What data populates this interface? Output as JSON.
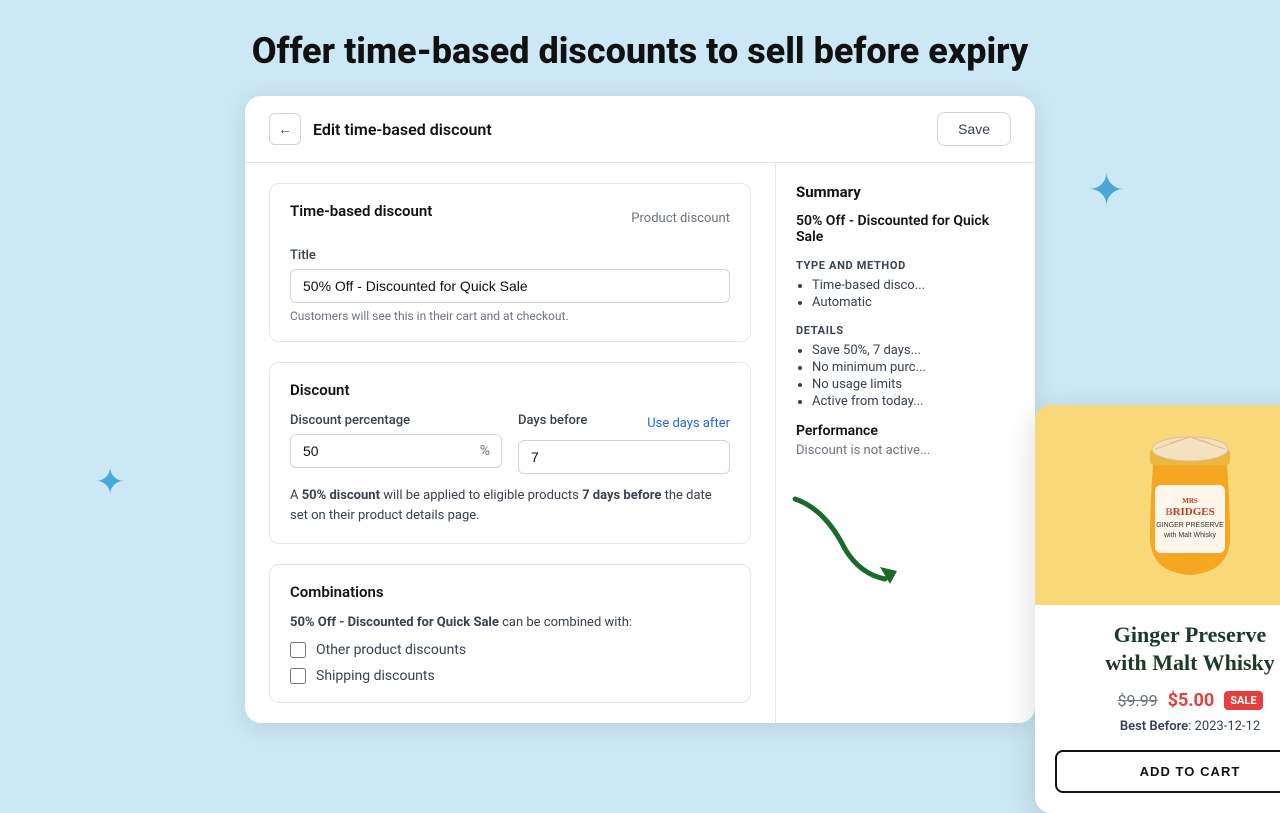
{
  "page": {
    "heading": "Offer time-based discounts to sell before expiry"
  },
  "header": {
    "title": "Edit time-based discount",
    "save_label": "Save",
    "back_icon": "←"
  },
  "time_based_discount": {
    "section_title": "Time-based discount",
    "product_discount_label": "Product discount",
    "title_label": "Title",
    "title_value": "50% Off - Discounted for Quick Sale",
    "title_hint": "Customers will see this in their cart and at checkout."
  },
  "discount": {
    "section_title": "Discount",
    "percentage_label": "Discount percentage",
    "percentage_value": "50",
    "percentage_suffix": "%",
    "days_label": "Days before",
    "days_value": "7",
    "use_days_after_link": "Use days after",
    "description_a": "A ",
    "description_bold1": "50% discount",
    "description_b": " will be applied to eligible products ",
    "description_bold2": "7 days before",
    "description_c": " the date set on their product details page."
  },
  "combinations": {
    "section_title": "Combinations",
    "description_bold": "50% Off - Discounted for Quick Sale",
    "description_text": " can be combined with:",
    "options": [
      {
        "label": "Other product discounts",
        "checked": false
      },
      {
        "label": "Shipping discounts",
        "checked": false
      }
    ]
  },
  "summary": {
    "title": "Summary",
    "discount_name": "50% Off - Discounted for Quick Sale",
    "type_method_label": "TYPE AND METHOD",
    "type_items": [
      "Time-based disco...",
      "Automatic"
    ],
    "details_label": "DETAILS",
    "details_items": [
      "Save 50%, 7 days...",
      "No minimum purc...",
      "No usage limits",
      "Active from today..."
    ],
    "performance_title": "Performance",
    "performance_status": "Discount is not active..."
  },
  "popup": {
    "product_name": "Ginger Preserve\nwith Malt Whisky",
    "original_price": "$9.99",
    "sale_price": "$5.00",
    "sale_badge": "SALE",
    "best_before_label": "Best Before",
    "best_before_date": "2023-12-12",
    "add_to_cart_label": "ADD TO CART",
    "close_icon": "×"
  },
  "colors": {
    "background": "#cce8f4",
    "star": "#4aa8d8",
    "sale_red": "#e53e3e",
    "jar_bg": "#f9d87a"
  }
}
